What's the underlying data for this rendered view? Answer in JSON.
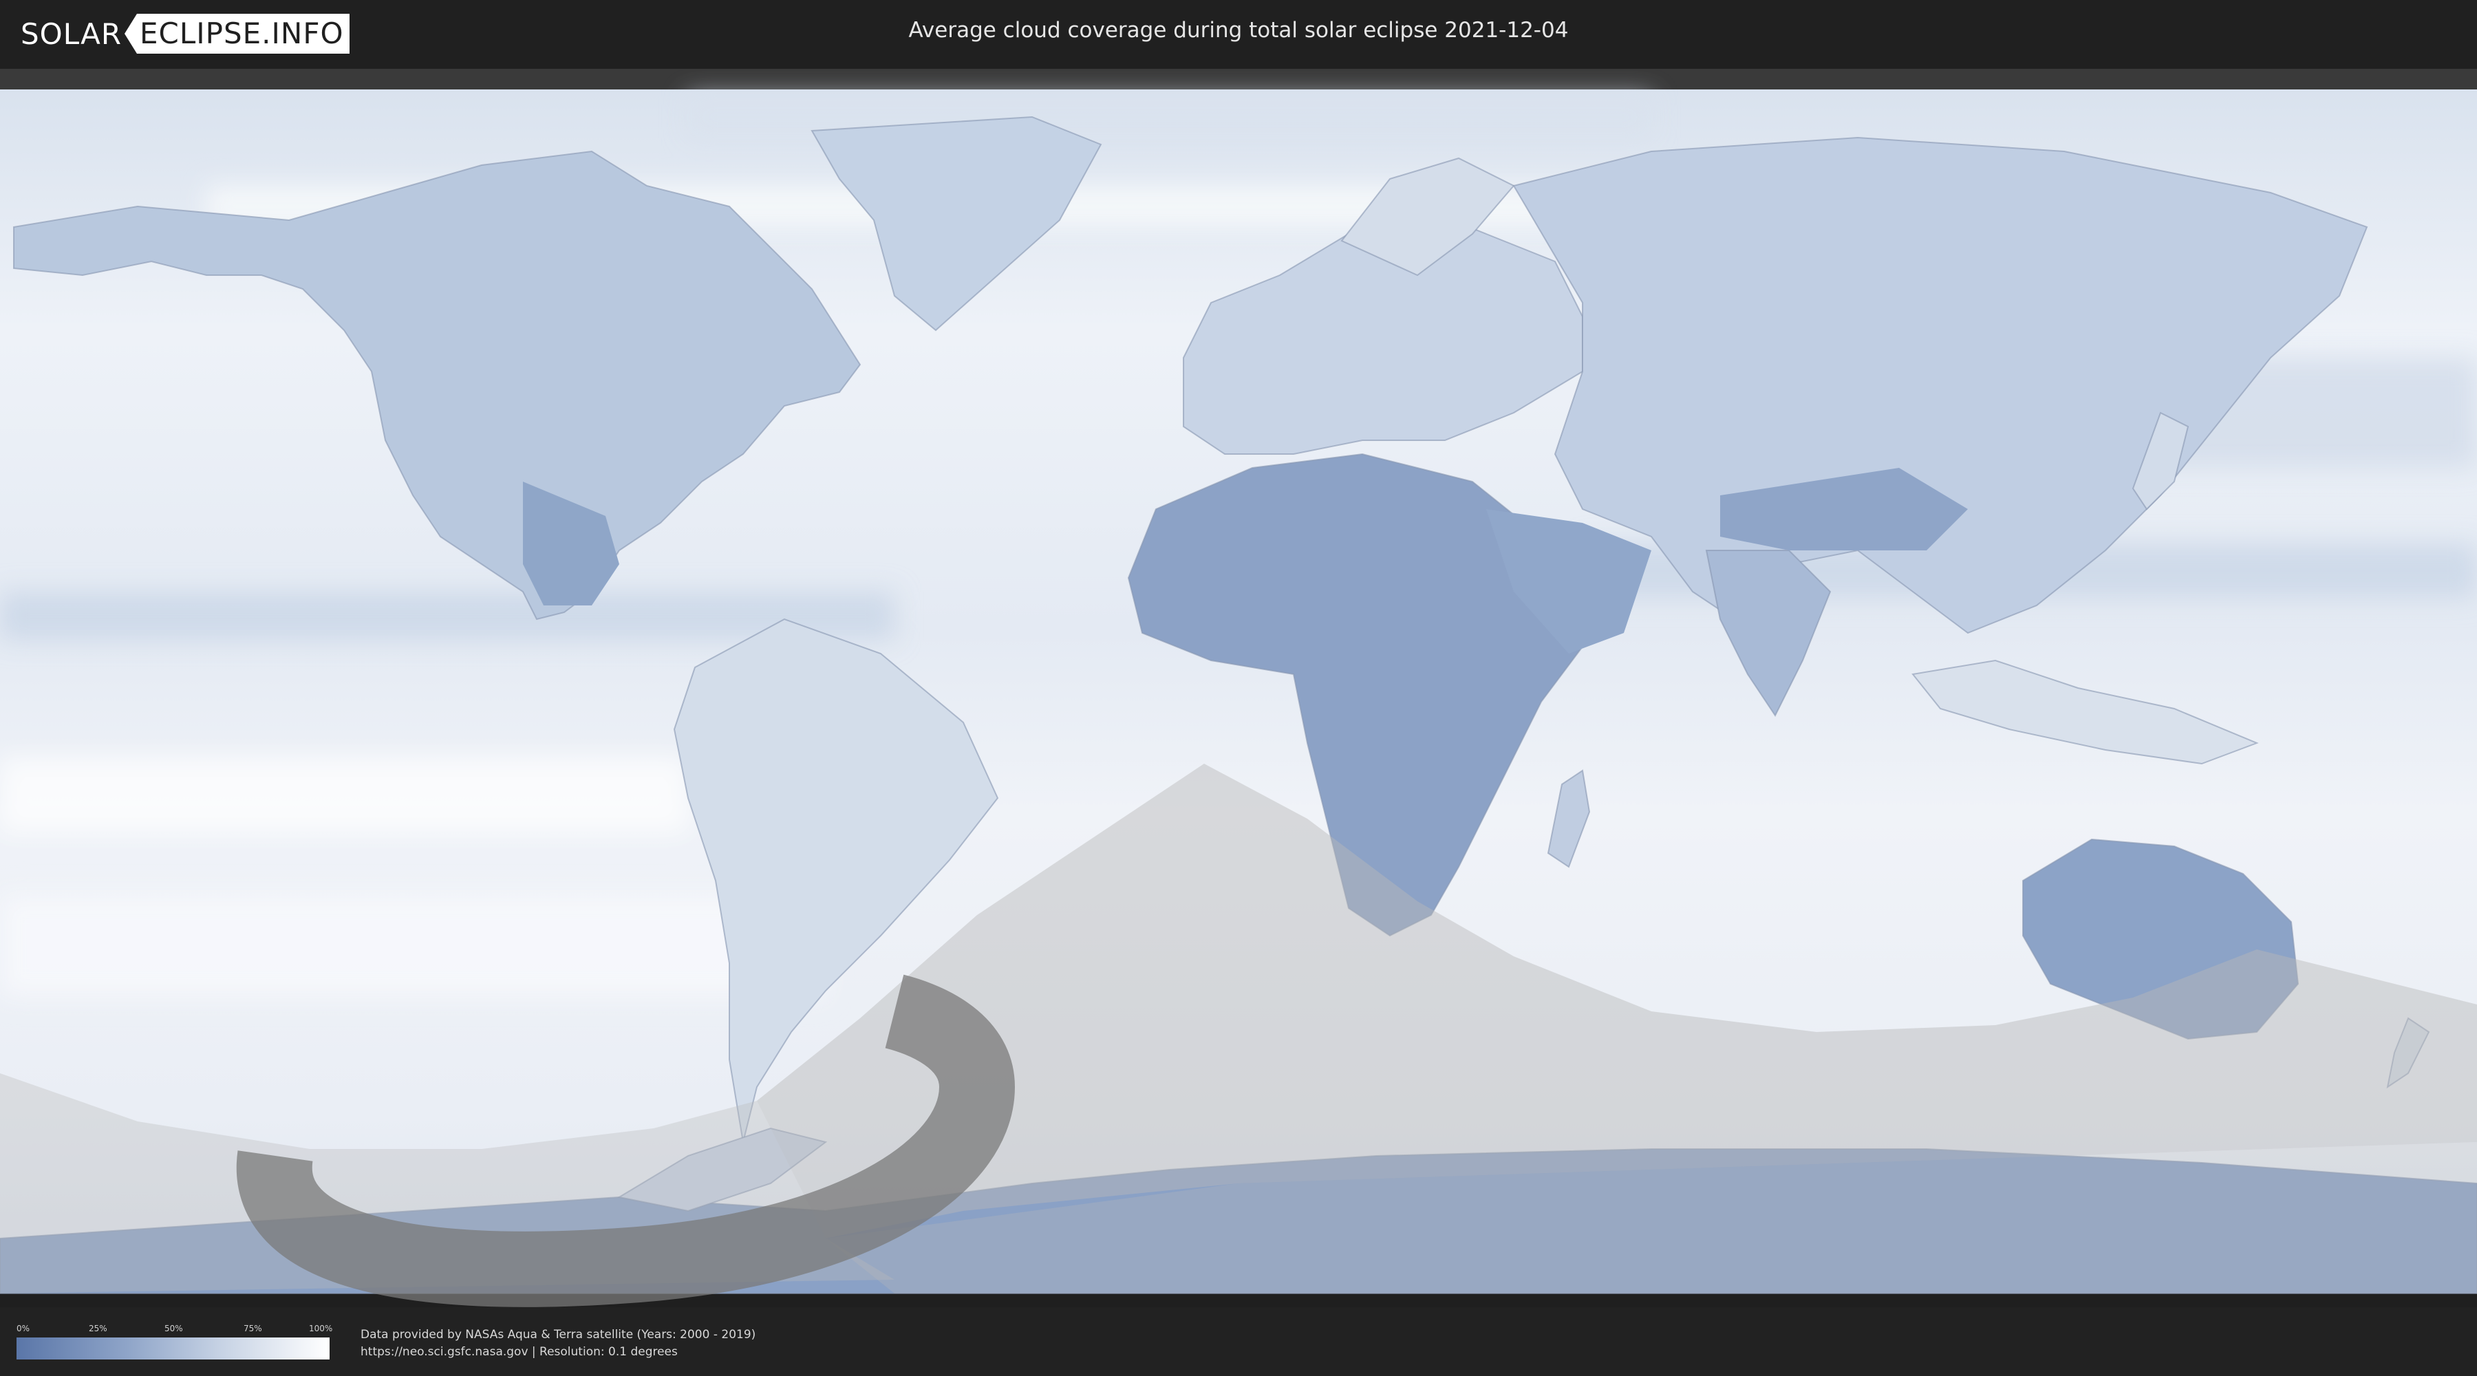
{
  "header": {
    "logo_left": "SOLAR",
    "logo_right": "ECLIPSE.INFO",
    "title": "Average cloud coverage during total solar eclipse 2021-12-04"
  },
  "legend": {
    "ticks": [
      "0%",
      "25%",
      "50%",
      "75%",
      "100%"
    ],
    "gradient_colors": [
      "#5a76a8",
      "#8ea4c8",
      "#c6d2e4",
      "#ffffff"
    ]
  },
  "credits": {
    "line1": "Data provided by NASAs Aqua & Terra satellite (Years: 2000 - 2019)",
    "line2": "https://neo.sci.gsfc.nasa.gov | Resolution: 0.1 degrees"
  },
  "colors": {
    "ocean_cloudy": "#eef2f8",
    "land_clear": "#7f98c2",
    "eclipse_overlay": "#b9b9b9",
    "totality_path": "#7a7a7a"
  },
  "icons": {
    "logo_arrow": "arrow-left-icon"
  }
}
